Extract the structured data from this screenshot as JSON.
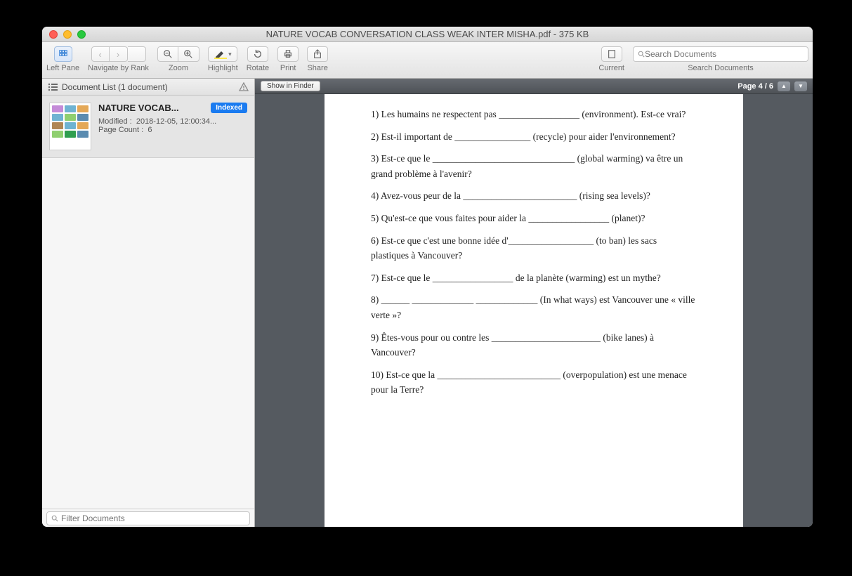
{
  "window": {
    "title": "NATURE VOCAB CONVERSATION CLASS WEAK INTER MISHA.pdf - 375 KB"
  },
  "toolbar": {
    "leftpane_label": "Left Pane",
    "navigate_label": "Navigate by Rank",
    "zoom_label": "Zoom",
    "highlight_label": "Highlight",
    "rotate_label": "Rotate",
    "print_label": "Print",
    "share_label": "Share",
    "current_label": "Current",
    "search_label": "Search Documents",
    "search_placeholder": "Search Documents"
  },
  "sidebar": {
    "heading": "Document List (1 document)",
    "doc": {
      "title": "NATURE VOCAB...",
      "badge": "Indexed",
      "modified_label": "Modified :",
      "modified_value": "2018-12-05, 12:00:34...",
      "pagecount_label": "Page Count :",
      "pagecount_value": "6"
    },
    "filter_placeholder": "Filter Documents"
  },
  "main": {
    "show_in_finder": "Show in Finder",
    "page_indicator": "Page 4 / 6"
  },
  "document": {
    "lines": [
      "1) Les humains ne respectent pas _________________ (environment). Est-ce vrai?",
      "2) Est-il important de ________________ (recycle) pour aider l'environnement?",
      "3) Est-ce que le ______________________________ (global warming) va être un grand problème à l'avenir?",
      "4) Avez-vous peur de la ________________________ (rising sea levels)?",
      "5) Qu'est-ce que vous faites pour aider la _________________ (planet)?",
      "6) Est-ce que c'est une bonne idée d'__________________ (to ban) les sacs plastiques à Vancouver?",
      "7) Est-ce que le _________________ de la planète (warming) est un mythe?",
      "8) ______ _____________ _____________ (In what ways) est Vancouver une « ville verte »?",
      "9) Êtes-vous pour ou contre les _______________________ (bike lanes) à Vancouver?",
      "10) Est-ce que la __________________________ (overpopulation) est une menace pour la Terre?"
    ]
  }
}
